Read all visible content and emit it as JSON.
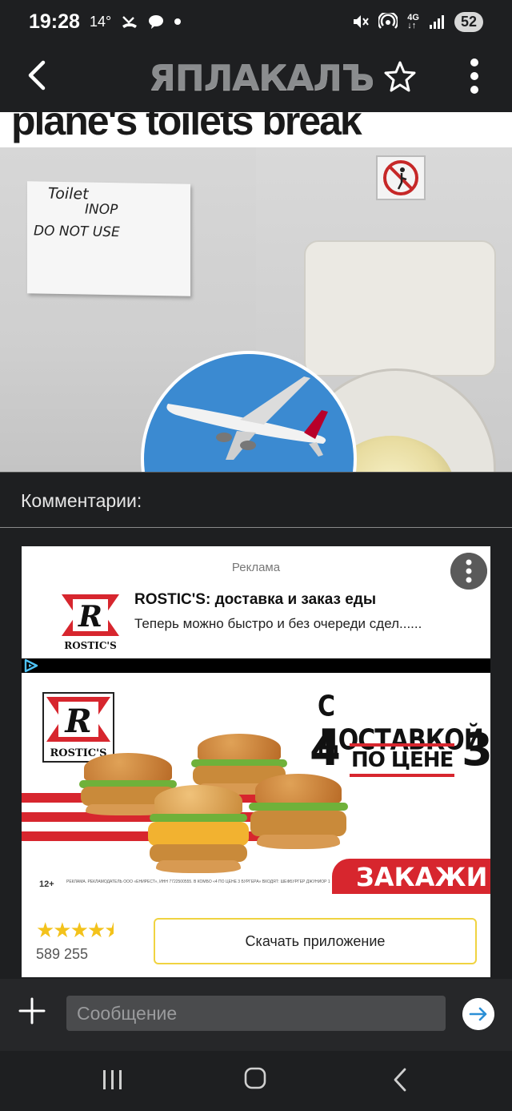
{
  "status_bar": {
    "time": "19:28",
    "temperature": "14°",
    "network": "4G",
    "battery": "52",
    "icons": [
      "missed-call-icon",
      "chat-bubble-icon",
      "dot-icon",
      "mute-icon",
      "hotspot-icon",
      "data-arrows-icon",
      "signal-icon"
    ]
  },
  "app_bar": {
    "logo": "ЯПЛАКАЛЪ",
    "icons": [
      "back-arrow-icon",
      "star-icon",
      "more-vertical-icon"
    ]
  },
  "article_image": {
    "headline_fragment": "plane's toilets break",
    "note_lines": [
      "Toilet",
      "INOP",
      "DO NOT USE"
    ]
  },
  "comments": {
    "title": "Комментарии:"
  },
  "ad": {
    "label": "Реклама",
    "title": "ROSTIC'S: доставка и заказ еды",
    "description": "Теперь можно быстро и без очереди сдел......",
    "brand": "ROSTIC'S",
    "brand_letter": "R",
    "banner": {
      "headline": "С ДОСТАВКОЙ",
      "number_left": "4",
      "price_text": "ПО ЦЕНЕ",
      "number_right": "3",
      "cta": "ЗАКАЖИ",
      "age": "12+",
      "legal": "РЕКЛАМА. РЕКЛАМОДАТЕЛЬ ООО «ЕНИРЕСТ», ИНН 7722500555. В КОМБО «4 ПО ЦЕНЕ 3 БУРГЕРА» ВХОДЯТ: ШЕФБУРГЕР ДЖУНИОР 1 ШТ, ЧИЗБУРГЕР"
    },
    "rating": {
      "stars": 4.5,
      "count": "589 255"
    },
    "button": "Скачать приложение",
    "colors": {
      "brand_red": "#d7262e",
      "star": "#f3c21b",
      "button_border": "#f0d341"
    }
  },
  "composer": {
    "placeholder": "Сообщение"
  },
  "nav_bar": {
    "icons": [
      "recent-apps-icon",
      "home-icon",
      "back-nav-icon"
    ]
  }
}
